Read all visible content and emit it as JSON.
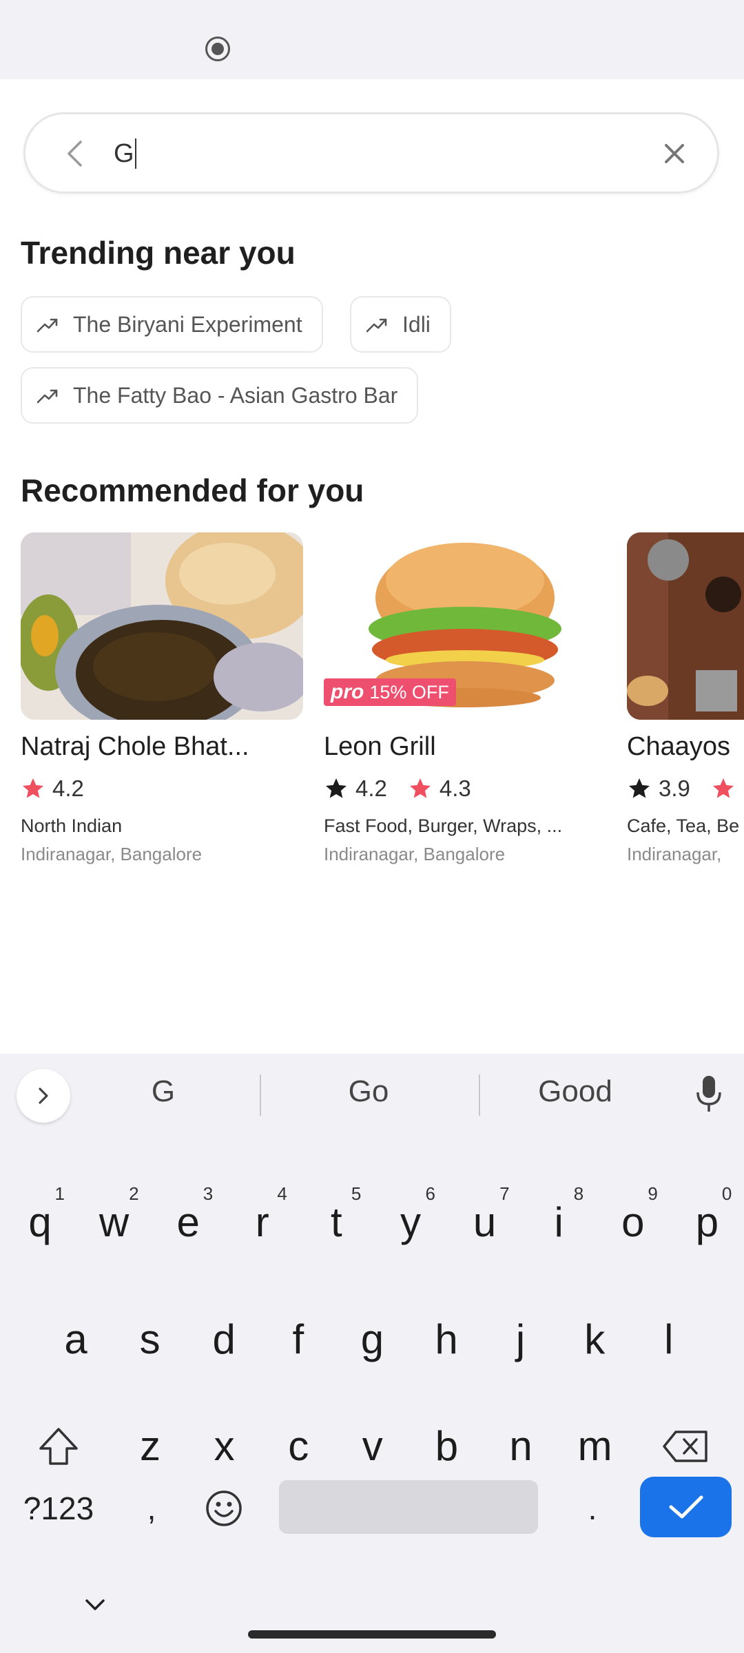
{
  "search": {
    "value": "G"
  },
  "trending": {
    "title": "Trending near you",
    "chips": [
      "The Biryani Experiment",
      "Idli",
      "The Fatty Bao - Asian Gastro Bar"
    ]
  },
  "recommended": {
    "title": "Recommended for you",
    "cards": [
      {
        "name": "Natraj Chole Bhat...",
        "ratings": [
          "4.2"
        ],
        "cuisine": "North Indian",
        "location": "Indiranagar, Bangalore"
      },
      {
        "name": "Leon Grill",
        "ratings": [
          "4.2",
          "4.3"
        ],
        "cuisine": "Fast Food, Burger, Wraps, ...",
        "location": "Indiranagar, Bangalore",
        "offer": {
          "pro": "pro",
          "text": "15% OFF"
        }
      },
      {
        "name": "Chaayos",
        "ratings": [
          "3.9"
        ],
        "cuisine": "Cafe, Tea, Be",
        "location": "Indiranagar,"
      }
    ]
  },
  "keyboard": {
    "suggestions": [
      "G",
      "Go",
      "Good"
    ],
    "row1": [
      "q",
      "w",
      "e",
      "r",
      "t",
      "y",
      "u",
      "i",
      "o",
      "p"
    ],
    "row1_numbers": [
      "1",
      "2",
      "3",
      "4",
      "5",
      "6",
      "7",
      "8",
      "9",
      "0"
    ],
    "row2": [
      "a",
      "s",
      "d",
      "f",
      "g",
      "h",
      "j",
      "k",
      "l"
    ],
    "row3": [
      "z",
      "x",
      "c",
      "v",
      "b",
      "n",
      "m"
    ],
    "symbols_label": "?123",
    "comma": ",",
    "period": "."
  },
  "colors": {
    "accent": "#1a73e8",
    "rating_star_red": "#ef4f5f",
    "rating_star_dark": "#1c1c1c",
    "offer_badge": "#ef4f6f"
  }
}
